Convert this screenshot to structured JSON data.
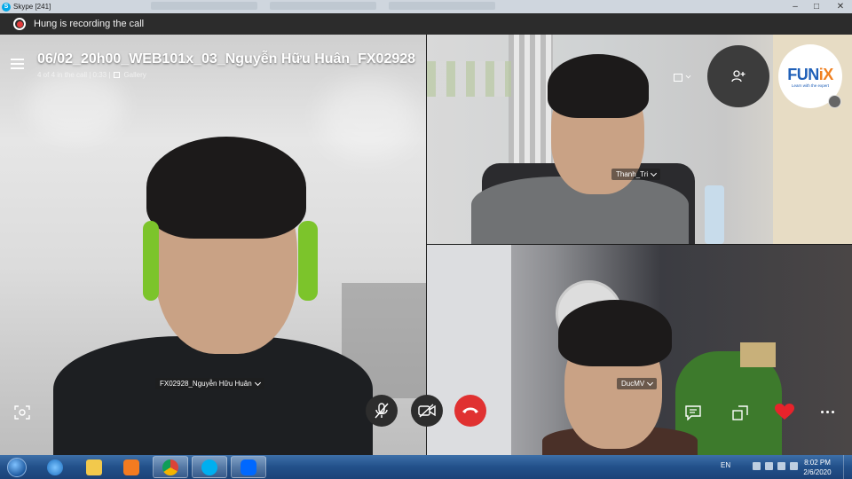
{
  "window": {
    "app_icon": "skype-icon",
    "title": "Skype [241]",
    "controls": [
      "minimize",
      "maximize",
      "close"
    ]
  },
  "recording": {
    "text": "Hung is recording the call"
  },
  "call": {
    "title": "06/02_20h00_WEB101x_03_Nguyễn Hữu Huân_FX02928",
    "meta": "4 of 4 in the call | 0:33 |",
    "view_mode": "Gallery"
  },
  "participants": [
    {
      "name": "FX02928_Nguyễn Hữu Huân"
    },
    {
      "name": "Thanh_Tri"
    },
    {
      "name": "DucMV"
    }
  ],
  "overlay_logo": {
    "brand": "FUNiX",
    "tagline": "Learn with the expert"
  },
  "controls": {
    "buttons": [
      "mic-off-icon",
      "video-off-icon",
      "end-call-icon",
      "chat-icon",
      "share-screen-icon",
      "heart-icon",
      "more-icon"
    ],
    "end_call_color": "#e03131"
  },
  "taskbar": {
    "apps": [
      "windows-start",
      "internet-explorer",
      "file-explorer",
      "media-player",
      "chrome",
      "skype",
      "zalo"
    ],
    "language": "EN",
    "time": "8:02 PM",
    "date": "2/6/2020"
  },
  "colors": {
    "recording_dot": "#e23b3b",
    "taskbar": "#22508a",
    "funix_blue": "#2060b8",
    "funix_orange": "#f08020"
  }
}
